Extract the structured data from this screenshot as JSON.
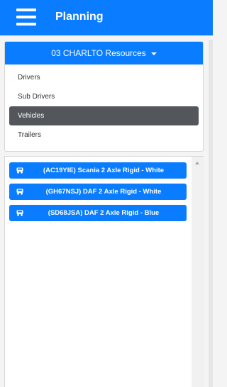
{
  "header": {
    "title": "Planning",
    "menu_icon": "hamburger-icon"
  },
  "resources": {
    "selected": "03 CHARLTO Resources",
    "items": [
      {
        "label": "Drivers"
      },
      {
        "label": "Sub Drivers"
      },
      {
        "label": "Vehicles",
        "active": true
      },
      {
        "label": "Trailers"
      }
    ]
  },
  "vehicles": [
    {
      "label": "(AC19YIE) Scania 2 Axle Rigid - White",
      "icon": "truck-icon"
    },
    {
      "label": "(GH67NSJ) DAF 2 Axle Rigid - White",
      "icon": "truck-icon"
    },
    {
      "label": "(SD68JSA) DAF 2 Axle Rigid - Blue",
      "icon": "truck-icon"
    }
  ],
  "colors": {
    "primary": "#0a7cff",
    "active_item": "#53575c"
  }
}
